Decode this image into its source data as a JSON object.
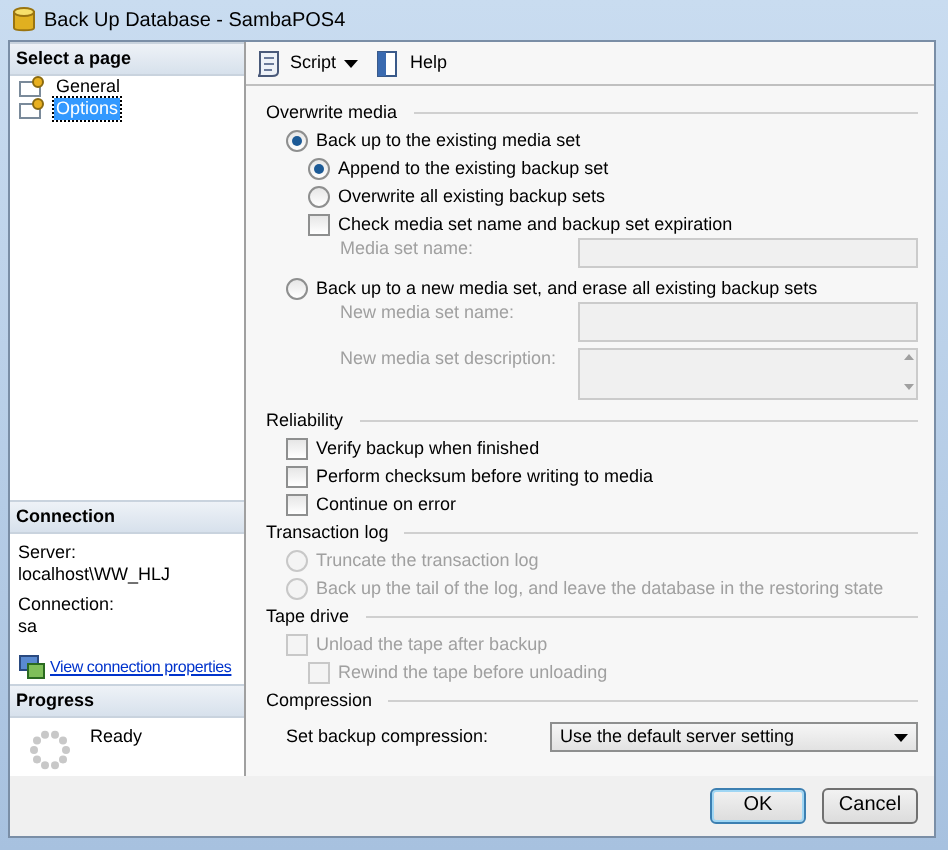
{
  "window": {
    "title": "Back Up Database - SambaPOS4"
  },
  "sidebar": {
    "header": "Select a page",
    "pages": [
      {
        "label": "General",
        "selected": false
      },
      {
        "label": "Options",
        "selected": true
      }
    ]
  },
  "connection": {
    "header": "Connection",
    "fields": [
      {
        "label": "Server:",
        "value": "localhost\\WW_HLJ"
      },
      {
        "label": "Connection:",
        "value": "sa"
      }
    ],
    "link": "View connection properties"
  },
  "progress": {
    "header": "Progress",
    "status": "Ready"
  },
  "toolbar": {
    "buttons": [
      {
        "label": "Script",
        "kind": "dropdown"
      },
      {
        "label": "Help",
        "kind": "help"
      }
    ]
  },
  "sections": [
    {
      "title": "Overwrite media",
      "items": [
        {
          "kind": "radio",
          "label": "Back up to the existing media set",
          "selected": true,
          "disabled": false,
          "children": [
            {
              "kind": "radio",
              "label": "Append to the existing backup set",
              "selected": true,
              "disabled": false
            },
            {
              "kind": "radio",
              "label": "Overwrite all existing backup sets",
              "selected": false,
              "disabled": false
            },
            {
              "kind": "checkbox",
              "label": "Check media set name and backup set expiration",
              "checked": false,
              "disabled": false
            },
            {
              "kind": "field",
              "label": "Media set name:",
              "disabled": true
            }
          ]
        },
        {
          "kind": "radio",
          "label": "Back up to a new media set, and erase all existing backup sets",
          "selected": false,
          "disabled": false,
          "children": [
            {
              "kind": "tallfield",
              "label": "New media set name:",
              "disabled": true
            },
            {
              "kind": "textarea",
              "label": "New media set description:",
              "disabled": true
            }
          ]
        }
      ]
    },
    {
      "title": "Reliability",
      "items": [
        {
          "kind": "checkbox",
          "label": "Verify backup when finished",
          "checked": false,
          "disabled": false
        },
        {
          "kind": "checkbox",
          "label": "Perform checksum before writing to media",
          "checked": false,
          "disabled": false
        },
        {
          "kind": "checkbox",
          "label": "Continue on error",
          "checked": false,
          "disabled": false
        }
      ]
    },
    {
      "title": "Transaction log",
      "items": [
        {
          "kind": "radio",
          "label": "Truncate the transaction log",
          "selected": false,
          "disabled": true
        },
        {
          "kind": "radio",
          "label": "Back up the tail of the log, and leave the database in the restoring state",
          "selected": false,
          "disabled": true
        }
      ]
    },
    {
      "title": "Tape drive",
      "items": [
        {
          "kind": "checkbox",
          "label": "Unload the tape after backup",
          "checked": false,
          "disabled": true,
          "children": [
            {
              "kind": "checkbox",
              "label": "Rewind the tape before unloading",
              "checked": false,
              "disabled": true
            }
          ]
        }
      ]
    },
    {
      "title": "Compression",
      "items": [
        {
          "kind": "combo",
          "label": "Set backup compression:",
          "value": "Use the default server setting",
          "disabled": false
        }
      ]
    }
  ],
  "buttons": [
    {
      "label": "OK",
      "default": true
    },
    {
      "label": "Cancel",
      "default": false
    }
  ]
}
